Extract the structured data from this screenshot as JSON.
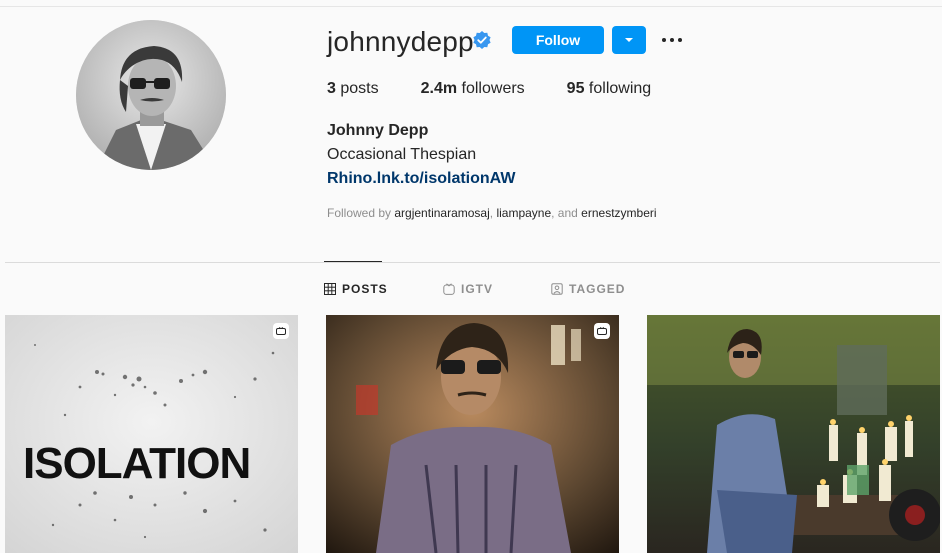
{
  "profile": {
    "username": "johnnydepp",
    "follow_label": "Follow",
    "stats": {
      "posts_count": "3",
      "posts_label": "posts",
      "followers_count": "2.4m",
      "followers_label": "followers",
      "following_count": "95",
      "following_label": "following"
    },
    "full_name": "Johnny Depp",
    "bio": "Occasional Thespian",
    "link": "Rhino.lnk.to/isolationAW",
    "followed_by": {
      "prefix": "Followed by ",
      "user1": "argjentinaramosaj",
      "sep1": ", ",
      "user2": "liampayne",
      "sep2": ", and ",
      "user3": "ernestzymberi"
    }
  },
  "tabs": {
    "posts": "POSTS",
    "igtv": "IGTV",
    "tagged": "TAGGED"
  },
  "posts": {
    "post1_text": "ISOLATION"
  },
  "colors": {
    "accent": "#0095f6",
    "link": "#00376b",
    "muted": "#8e8e8e",
    "verified": "#3897f0"
  },
  "icons": [
    "verified-badge-icon",
    "chevron-down-icon",
    "more-options-icon",
    "grid-icon",
    "igtv-icon",
    "tagged-icon",
    "video-badge-icon"
  ]
}
